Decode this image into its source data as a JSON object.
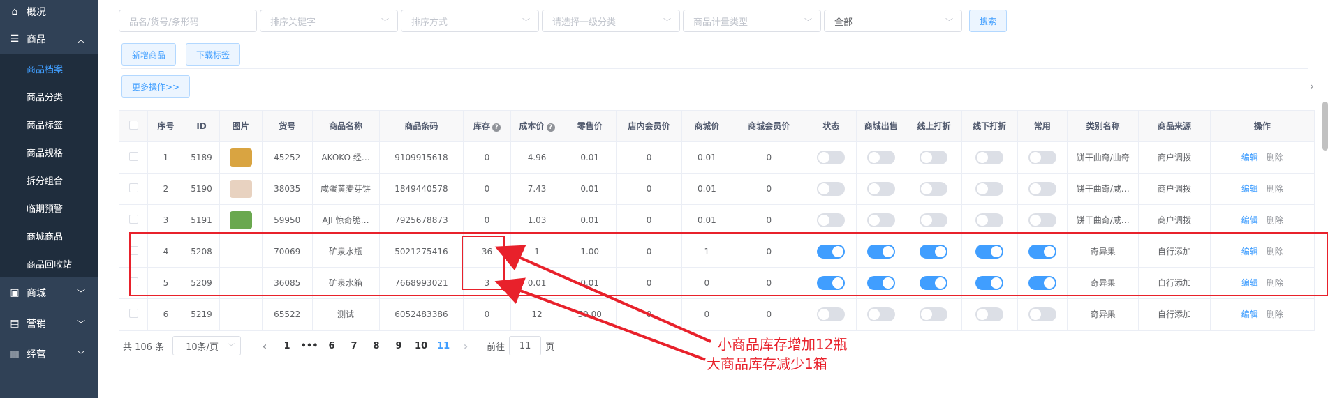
{
  "sidebar": {
    "top_label": "概况",
    "goods_group": "商品",
    "sub_items": [
      "商品档案",
      "商品分类",
      "商品标签",
      "商品规格",
      "拆分组合",
      "临期预警",
      "商城商品",
      "商品回收站"
    ],
    "mall_group": "商城",
    "marketing_group": "营销",
    "business_group": "经营"
  },
  "filters": {
    "keyword_placeholder": "品名/货号/条形码",
    "sort_key_placeholder": "排序关键字",
    "sort_order_placeholder": "排序方式",
    "category_placeholder": "请选择一级分类",
    "unit_type_placeholder": "商品计量类型",
    "all_value": "全部",
    "search_label": "搜索"
  },
  "actions": {
    "add_label": "新增商品",
    "download_label": "下载标签",
    "more_label": "更多操作>>"
  },
  "table": {
    "headers": [
      "序号",
      "ID",
      "图片",
      "货号",
      "商品名称",
      "商品条码",
      "库存",
      "成本价",
      "零售价",
      "店内会员价",
      "商城价",
      "商城会员价",
      "状态",
      "商城出售",
      "线上打折",
      "线下打折",
      "常用",
      "类别名称",
      "商品来源",
      "操作"
    ],
    "edit_label": "编辑",
    "delete_label": "删除",
    "rows": [
      {
        "no": "1",
        "id": "5189",
        "sku": "45252",
        "name": "AKOKO 经…",
        "barcode": "9109915618",
        "stock": "0",
        "cost": "4.96",
        "retail": "0.01",
        "member": "0",
        "mall": "0.01",
        "mall_member": "0",
        "switches": [
          false,
          false,
          false,
          false,
          false
        ],
        "category": "饼干曲奇/曲奇",
        "source": "商户调拨",
        "img_color": "#d9a441"
      },
      {
        "no": "2",
        "id": "5190",
        "sku": "38035",
        "name": "咸蛋黄麦芽饼",
        "barcode": "1849440578",
        "stock": "0",
        "cost": "7.43",
        "retail": "0.01",
        "member": "0",
        "mall": "0.01",
        "mall_member": "0",
        "switches": [
          false,
          false,
          false,
          false,
          false
        ],
        "category": "饼干曲奇/咸…",
        "source": "商户调拨",
        "img_color": "#e8d2c0"
      },
      {
        "no": "3",
        "id": "5191",
        "sku": "59950",
        "name": "AJI 惊奇脆…",
        "barcode": "7925678873",
        "stock": "0",
        "cost": "1.03",
        "retail": "0.01",
        "member": "0",
        "mall": "0.01",
        "mall_member": "0",
        "switches": [
          false,
          false,
          false,
          false,
          false
        ],
        "category": "饼干曲奇/咸…",
        "source": "商户调拨",
        "img_color": "#6aa84f"
      },
      {
        "no": "4",
        "id": "5208",
        "sku": "70069",
        "name": "矿泉水瓶",
        "barcode": "5021275416",
        "stock": "36",
        "cost": "1",
        "retail": "1.00",
        "member": "0",
        "mall": "1",
        "mall_member": "0",
        "switches": [
          true,
          true,
          true,
          true,
          true
        ],
        "category": "奇异果",
        "source": "自行添加",
        "img_color": ""
      },
      {
        "no": "5",
        "id": "5209",
        "sku": "36085",
        "name": "矿泉水箱",
        "barcode": "7668993021",
        "stock": "3",
        "cost": "0.01",
        "retail": "0.01",
        "member": "0",
        "mall": "0",
        "mall_member": "0",
        "switches": [
          true,
          true,
          true,
          true,
          true
        ],
        "category": "奇异果",
        "source": "自行添加",
        "img_color": ""
      },
      {
        "no": "6",
        "id": "5219",
        "sku": "65522",
        "name": "测试",
        "barcode": "6052483386",
        "stock": "0",
        "cost": "12",
        "retail": "50.00",
        "member": "0",
        "mall": "0",
        "mall_member": "0",
        "switches": [
          false,
          false,
          false,
          false,
          false
        ],
        "category": "奇异果",
        "source": "自行添加",
        "img_color": ""
      }
    ]
  },
  "pager": {
    "total": "共 106 条",
    "page_size": "10条/页",
    "prev": "‹",
    "pages": [
      "1",
      "•••",
      "6",
      "7",
      "8",
      "9",
      "10",
      "11"
    ],
    "active_page": "11",
    "next": "›",
    "goto_prefix": "前往",
    "goto_value": "11",
    "goto_suffix": "页"
  },
  "annotations": {
    "line1": "小商品库存增加12瓶",
    "line2": "大商品库存减少1箱",
    "color": "#e8212b"
  }
}
